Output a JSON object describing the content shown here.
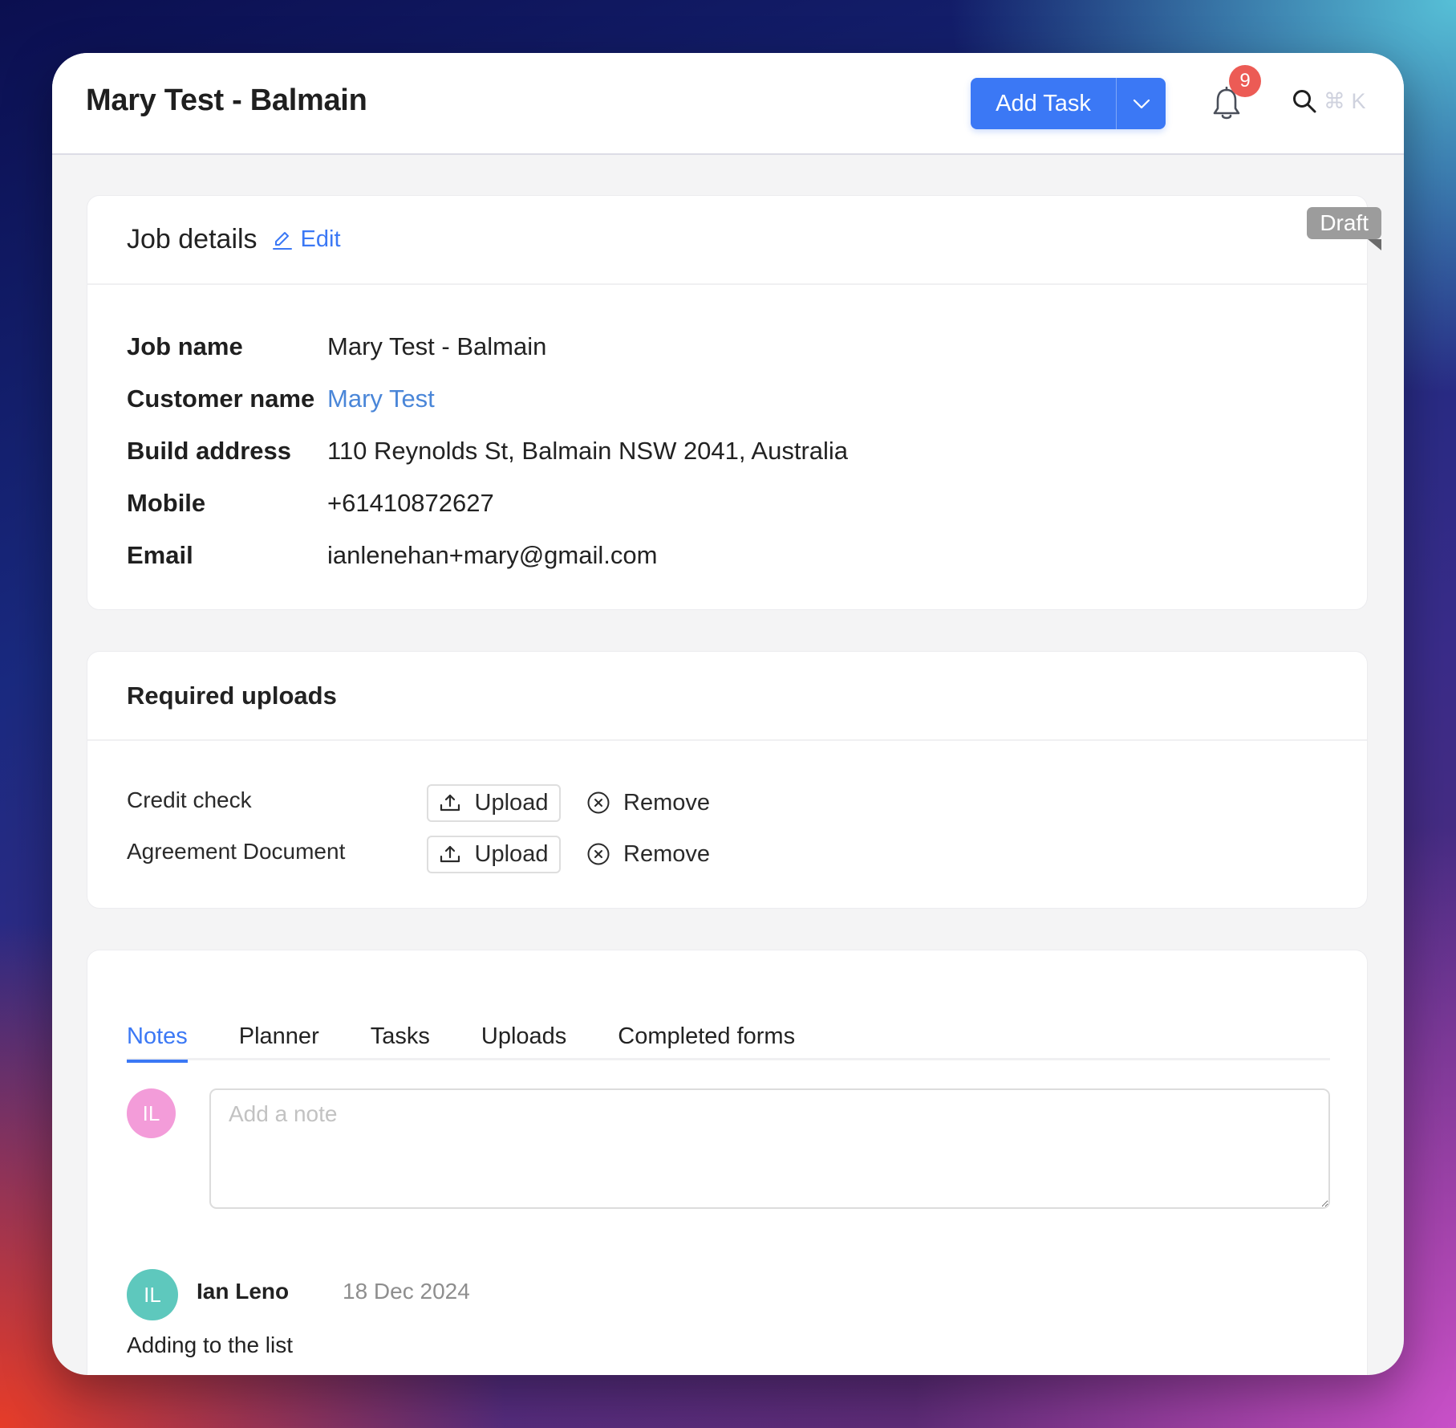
{
  "header": {
    "title": "Mary Test - Balmain",
    "add_task_label": "Add Task",
    "dropdown_icon": "chevron-down-icon",
    "notification_icon": "bell-icon",
    "notification_count": "9",
    "search_icon": "search-icon",
    "search_shortcut": "⌘ K"
  },
  "colors": {
    "accent": "#3b78f5",
    "badge": "#ec5b55",
    "draft_badge": "#9c9c9c",
    "link": "#4a86d8",
    "avatar_composer": "#f39cd9",
    "avatar_note": "#5ec8bd"
  },
  "job_details": {
    "title": "Job details",
    "edit_label": "Edit",
    "status_badge": "Draft",
    "rows": [
      {
        "label": "Job name",
        "value": "Mary Test - Balmain"
      },
      {
        "label": "Customer name",
        "value": "Mary Test"
      },
      {
        "label": "Build address",
        "value": "110 Reynolds St, Balmain NSW 2041, Australia"
      },
      {
        "label": "Mobile",
        "value": "+61410872627"
      },
      {
        "label": "Email",
        "value": "ianlenehan+mary@gmail.com"
      }
    ]
  },
  "required_uploads": {
    "title": "Required uploads",
    "items": [
      {
        "label": "Credit check",
        "upload_label": "Upload",
        "remove_label": "Remove"
      },
      {
        "label": "Agreement Document",
        "upload_label": "Upload",
        "remove_label": "Remove"
      }
    ]
  },
  "tabs": [
    {
      "label": "Notes",
      "active": true
    },
    {
      "label": "Planner",
      "active": false
    },
    {
      "label": "Tasks",
      "active": false
    },
    {
      "label": "Uploads",
      "active": false
    },
    {
      "label": "Completed forms",
      "active": false
    }
  ],
  "notes": {
    "composer": {
      "avatar_initials": "IL",
      "placeholder": "Add a note",
      "value": ""
    },
    "items": [
      {
        "avatar_initials": "IL",
        "author": "Ian Leno",
        "date": "18 Dec 2024",
        "body": "Adding to the list"
      }
    ]
  }
}
